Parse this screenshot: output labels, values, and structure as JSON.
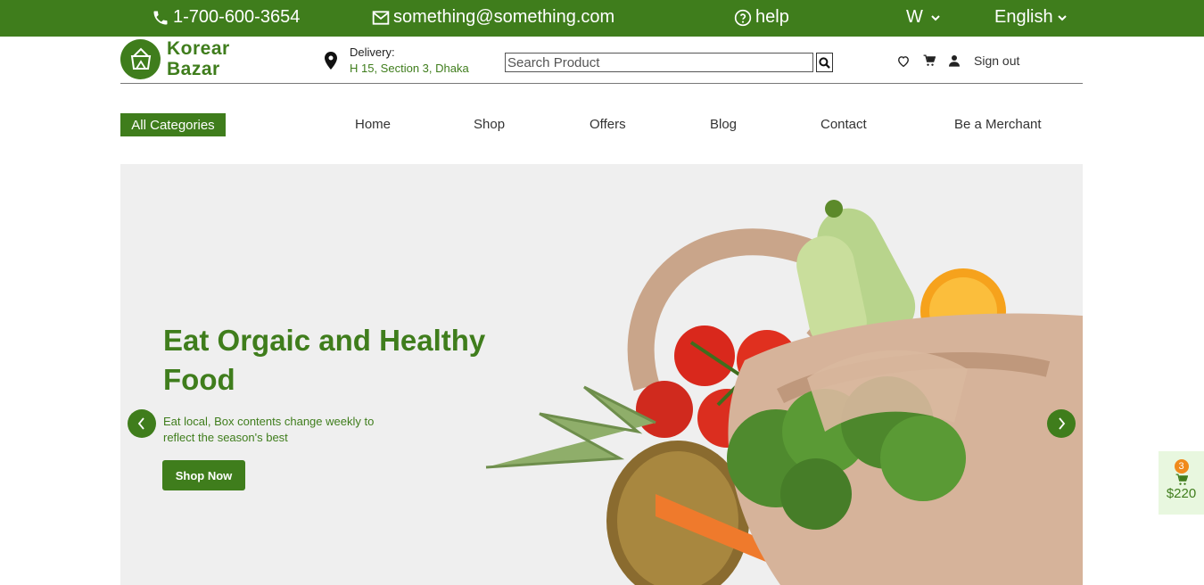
{
  "topbar": {
    "phone": "1-700-600-3654",
    "email": "something@something.com",
    "help": "help",
    "user_initial": "W",
    "language": "English"
  },
  "brand": {
    "line1": "Korear",
    "line2": "Bazar"
  },
  "delivery": {
    "label": "Delivery:",
    "address": "H 15, Section 3, Dhaka"
  },
  "search": {
    "placeholder": "Search Product"
  },
  "account": {
    "signout": "Sign out"
  },
  "nav": {
    "categories": "All Categories",
    "items": [
      "Home",
      "Shop",
      "Offers",
      "Blog",
      "Contact",
      "Be a Merchant"
    ]
  },
  "hero": {
    "title": "Eat Orgaic and Healthy Food",
    "subtitle": "Eat local, Box contents change weekly to reflect the season's best",
    "cta": "Shop Now"
  },
  "cart": {
    "count": "3",
    "total": "$220"
  },
  "colors": {
    "brand_green": "#3f7d1c",
    "badge_orange": "#f08a1c",
    "cart_bg": "#e8f7df"
  }
}
